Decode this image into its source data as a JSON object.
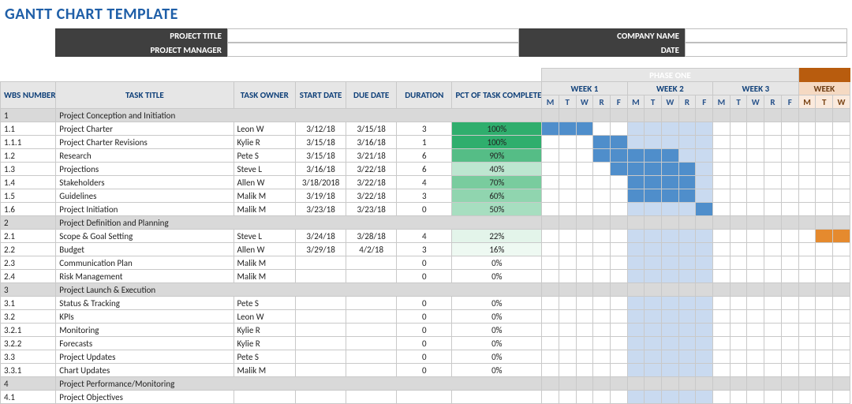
{
  "title": "GANTT CHART TEMPLATE",
  "meta": {
    "project_title_label": "PROJECT TITLE",
    "project_title_value": "",
    "company_name_label": "COMPANY NAME",
    "company_name_value": "",
    "project_manager_label": "PROJECT MANAGER",
    "project_manager_value": "",
    "date_label": "DATE",
    "date_value": ""
  },
  "columns": {
    "wbs": "WBS NUMBER",
    "task": "TASK TITLE",
    "owner": "TASK OWNER",
    "start": "START DATE",
    "due": "DUE DATE",
    "duration": "DURATION",
    "pct": "PCT OF TASK COMPLETE"
  },
  "phases": {
    "phase1": "PHASE ONE",
    "week1": "WEEK 1",
    "week2": "WEEK 2",
    "week3": "WEEK 3",
    "week4": "WEEK",
    "days": [
      "M",
      "T",
      "W",
      "R",
      "F",
      "M",
      "T",
      "W",
      "R",
      "F",
      "M",
      "T",
      "W",
      "R",
      "F",
      "M",
      "T",
      "W"
    ]
  },
  "rows": [
    {
      "type": "section",
      "wbs": "1",
      "task": "Project Conception and Initiation"
    },
    {
      "type": "task",
      "wbs": "1.1",
      "task": "Project Charter",
      "owner": "Leon W",
      "start": "3/12/18",
      "due": "3/15/18",
      "duration": "3",
      "pct": 100,
      "bar": {
        "start": 0,
        "len": 3,
        "cls": "barA"
      }
    },
    {
      "type": "task",
      "wbs": "1.1.1",
      "task": "Project Charter Revisions",
      "owner": "Kylie R",
      "start": "3/15/18",
      "due": "3/16/18",
      "duration": "1",
      "pct": 100,
      "bar": {
        "start": 3,
        "len": 2,
        "cls": "barA"
      }
    },
    {
      "type": "task",
      "wbs": "1.2",
      "task": "Research",
      "owner": "Pete S",
      "start": "3/15/18",
      "due": "3/21/18",
      "duration": "6",
      "pct": 90,
      "bar": {
        "start": 3,
        "len": 5,
        "cls": "barA"
      }
    },
    {
      "type": "task",
      "wbs": "1.3",
      "task": "Projections",
      "owner": "Steve L",
      "start": "3/16/18",
      "due": "3/22/18",
      "duration": "6",
      "pct": 40,
      "bar": {
        "start": 4,
        "len": 5,
        "cls": "barA"
      }
    },
    {
      "type": "task",
      "wbs": "1.4",
      "task": "Stakeholders",
      "owner": "Allen W",
      "start": "3/18/2018",
      "due": "3/22/18",
      "duration": "4",
      "pct": 70,
      "bar": {
        "start": 5,
        "len": 4,
        "cls": "barA"
      }
    },
    {
      "type": "task",
      "wbs": "1.5",
      "task": "Guidelines",
      "owner": "Malik M",
      "start": "3/19/18",
      "due": "3/22/18",
      "duration": "3",
      "pct": 60,
      "bar": {
        "start": 5,
        "len": 4,
        "cls": "barA"
      }
    },
    {
      "type": "task",
      "wbs": "1.6",
      "task": "Project Initiation",
      "owner": "Malik M",
      "start": "3/23/18",
      "due": "3/23/18",
      "duration": "0",
      "pct": 50,
      "bar": {
        "start": 9,
        "len": 1,
        "cls": "barA"
      }
    },
    {
      "type": "section",
      "wbs": "2",
      "task": "Project Definition and Planning"
    },
    {
      "type": "task",
      "wbs": "2.1",
      "task": "Scope & Goal Setting",
      "owner": "Steve L",
      "start": "3/24/18",
      "due": "3/28/18",
      "duration": "4",
      "pct": 22,
      "bar": {
        "start": 16,
        "len": 2,
        "cls": "barB"
      }
    },
    {
      "type": "task",
      "wbs": "2.2",
      "task": "Budget",
      "owner": "Allen W",
      "start": "3/29/18",
      "due": "4/2/18",
      "duration": "3",
      "pct": 16
    },
    {
      "type": "task",
      "wbs": "2.3",
      "task": "Communication Plan",
      "owner": "Malik M",
      "start": "",
      "due": "",
      "duration": "0",
      "pct": 0
    },
    {
      "type": "task",
      "wbs": "2.4",
      "task": "Risk Management",
      "owner": "Malik M",
      "start": "",
      "due": "",
      "duration": "0",
      "pct": 0
    },
    {
      "type": "section",
      "wbs": "3",
      "task": "Project Launch & Execution"
    },
    {
      "type": "task",
      "wbs": "3.1",
      "task": "Status & Tracking",
      "owner": "Pete S",
      "start": "",
      "due": "",
      "duration": "0",
      "pct": 0
    },
    {
      "type": "task",
      "wbs": "3.2",
      "task": "KPIs",
      "owner": "Leon W",
      "start": "",
      "due": "",
      "duration": "0",
      "pct": 0
    },
    {
      "type": "task",
      "wbs": "3.2.1",
      "task": "Monitoring",
      "owner": "Kylie R",
      "start": "",
      "due": "",
      "duration": "0",
      "pct": 0
    },
    {
      "type": "task",
      "wbs": "3.2.2",
      "task": "Forecasts",
      "owner": "Kylie R",
      "start": "",
      "due": "",
      "duration": "0",
      "pct": 0
    },
    {
      "type": "task",
      "wbs": "3.3",
      "task": "Project Updates",
      "owner": "Pete S",
      "start": "",
      "due": "",
      "duration": "0",
      "pct": 0
    },
    {
      "type": "task",
      "wbs": "3.3.1",
      "task": "Chart Updates",
      "owner": "Malik M",
      "start": "",
      "due": "",
      "duration": "0",
      "pct": 0
    },
    {
      "type": "section",
      "wbs": "4",
      "task": "Project Performance/Monitoring"
    },
    {
      "type": "task",
      "wbs": "4.1",
      "task": "Project Objectives",
      "owner": "",
      "start": "",
      "due": "",
      "duration": "",
      "pct": null
    }
  ],
  "pct_colors": {
    "100": "#2fae6d",
    "90": "#55bd86",
    "70": "#79cc9e",
    "60": "#90d5af",
    "50": "#a7dec0",
    "40": "#bde6d0",
    "22": "#e3f4ea",
    "16": "#eef9f2",
    "0": "#ffffff"
  }
}
